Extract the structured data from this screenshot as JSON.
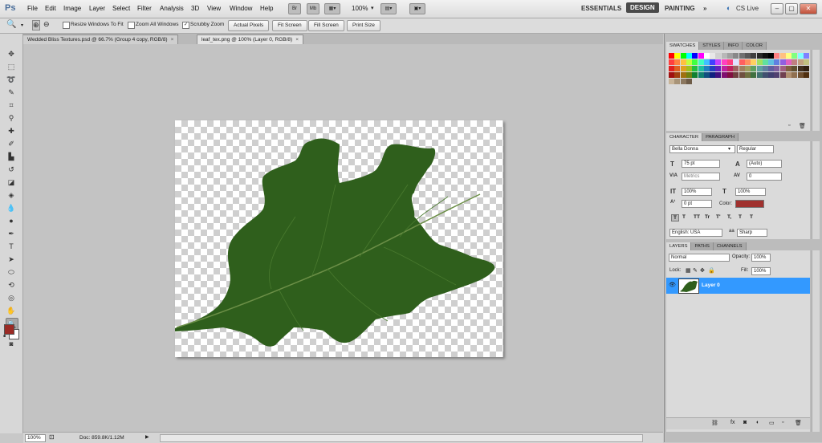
{
  "app": {
    "logo": "Ps"
  },
  "menu": [
    "File",
    "Edit",
    "Image",
    "Layer",
    "Select",
    "Filter",
    "Analysis",
    "3D",
    "View",
    "Window",
    "Help"
  ],
  "menubar_buttons": {
    "bridge": "Br",
    "minibridge": "Mb"
  },
  "zoom_menu_value": "100%",
  "workspaces": {
    "essentials": "ESSENTIALS",
    "design": "DESIGN",
    "painting": "PAINTING",
    "more": "»",
    "cslive": "CS Live"
  },
  "options": {
    "resize_windows": "Resize Windows To Fit",
    "zoom_all": "Zoom All Windows",
    "scrubby": "Scrubby Zoom",
    "scrubby_checked": "✓",
    "actual": "Actual Pixels",
    "fit": "Fit Screen",
    "fill": "Fill Screen",
    "print": "Print Size"
  },
  "tabs": [
    {
      "label": "Wedded Bliss Textures.psd @ 66.7% (Group 4 copy, RGB/8)"
    },
    {
      "label": "leaf_tex.png @ 100% (Layer 0, RGB/8)"
    }
  ],
  "tab_close": "×",
  "status": {
    "zoom": "100%",
    "doc": "Doc: 859.8K/1.12M"
  },
  "swatches_panel": {
    "tabs": [
      "SWATCHES",
      "STYLES",
      "INFO",
      "COLOR"
    ]
  },
  "swatches": [
    "#ff0000",
    "#ffff00",
    "#00ff00",
    "#00ffff",
    "#0000ff",
    "#ff00ff",
    "#ffffff",
    "#e8e8e8",
    "#d0d0d0",
    "#b8b8b8",
    "#a0a0a0",
    "#888888",
    "#707070",
    "#585858",
    "#404040",
    "#282828",
    "#101010",
    "#000000",
    "#ff8080",
    "#ffc080",
    "#ffff80",
    "#80ff80",
    "#80ffff",
    "#8080ff",
    "#ff4040",
    "#ff8040",
    "#ffc040",
    "#c0ff40",
    "#40ff40",
    "#40ffc0",
    "#40c0ff",
    "#4040ff",
    "#c040ff",
    "#ff40c0",
    "#ff4080",
    "#e0e0ff",
    "#ff6060",
    "#ff9060",
    "#ffd060",
    "#a0e060",
    "#60e0a0",
    "#60c0e0",
    "#6080e0",
    "#9060e0",
    "#e060c0",
    "#c08080",
    "#c0a080",
    "#c0c080",
    "#e02020",
    "#e06020",
    "#e0a020",
    "#a0c020",
    "#20c040",
    "#20c0a0",
    "#2080c0",
    "#2040c0",
    "#6020c0",
    "#c020a0",
    "#c02060",
    "#a06060",
    "#a08060",
    "#a0a060",
    "#60a060",
    "#60a0a0",
    "#6080a0",
    "#6060a0",
    "#8060a0",
    "#a06080",
    "#806040",
    "#605030",
    "#403020",
    "#302010",
    "#a01010",
    "#a04010",
    "#a07010",
    "#708010",
    "#108030",
    "#108070",
    "#105080",
    "#102080",
    "#401080",
    "#801070",
    "#801040",
    "#704040",
    "#705040",
    "#707040",
    "#407040",
    "#407070",
    "#405070",
    "#404070",
    "#504070",
    "#704050",
    "#b09070",
    "#907050",
    "#705030",
    "#503010",
    "#c8b498",
    "#a89478",
    "#8c7860",
    "#6e5c48"
  ],
  "character_panel": {
    "tabs": [
      "CHARACTER",
      "PARAGRAPH"
    ],
    "font_family": "Bella Donna",
    "font_style": "Regular",
    "size": "75 pt",
    "leading": "(Auto)",
    "kerning": "Metrics",
    "tracking": "0",
    "vscale": "100%",
    "hscale": "100%",
    "baseline": "0 pt",
    "color_label": "Color:",
    "color": "#a0312e",
    "language": "English: USA",
    "antialias": "Sharp",
    "style_buttons": [
      "T",
      "T",
      "TT",
      "Tr",
      "T'",
      "T,",
      "T",
      "T"
    ]
  },
  "layers_panel": {
    "tabs": [
      "LAYERS",
      "PATHS",
      "CHANNELS"
    ],
    "blend": "Normal",
    "opacity_label": "Opacity:",
    "opacity": "100%",
    "lock_label": "Lock:",
    "fill_label": "Fill:",
    "fill": "100%",
    "layers": [
      {
        "name": "Layer 0",
        "selected": true
      }
    ]
  },
  "colors": {
    "foreground": "#9b2b25",
    "background": "#ffffff",
    "selection": "#3399ff",
    "leaf": "#2f5f1c"
  }
}
